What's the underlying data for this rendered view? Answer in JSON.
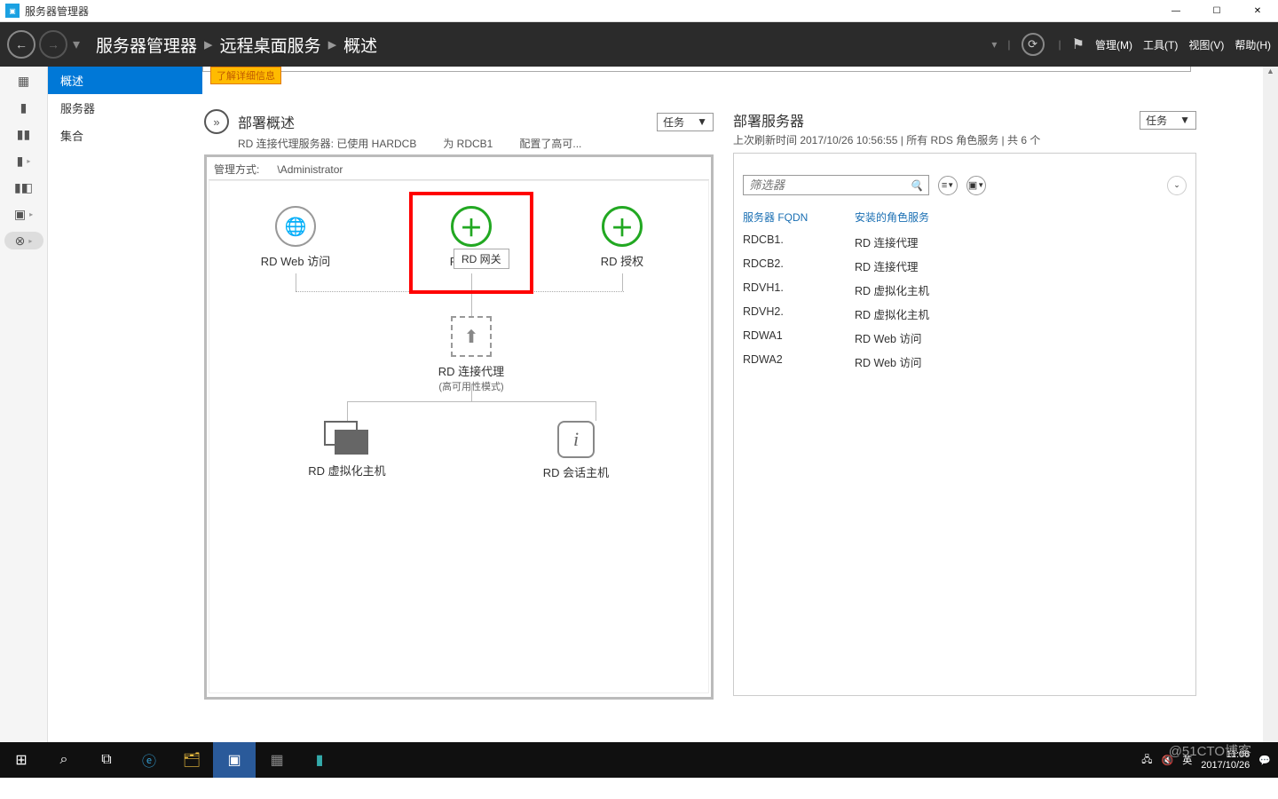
{
  "title": "服务器管理器",
  "winbtns": {
    "min": "—",
    "max": "☐",
    "close": "✕"
  },
  "breadcrumb": {
    "a": "服务器管理器",
    "b": "远程桌面服务",
    "c": "概述",
    "sep": "▸"
  },
  "menus": {
    "manage": "管理(M)",
    "tools": "工具(T)",
    "view": "视图(V)",
    "help": "帮助(H)"
  },
  "leftnav": {
    "overview": "概述",
    "servers": "服务器",
    "collections": "集合"
  },
  "notice": "了解详细信息",
  "deploy": {
    "title": "部署概述",
    "sub1": "RD 连接代理服务器: 已使用 HARDCB",
    "sub2": "为 RDCB1",
    "sub3": "配置了高可...",
    "tasks": "任务",
    "mgmt_label": "管理方式:",
    "mgmt_val": "\\Administrator",
    "nodes": {
      "web": "RD Web 访问",
      "gw": "RD 网关",
      "auth": "RD 授权",
      "broker": "RD 连接代理",
      "broker_sub": "(高可用性模式)",
      "vhost": "RD 虚拟化主机",
      "shost": "RD 会话主机"
    },
    "tooltip": "RD 网关"
  },
  "servers": {
    "title": "部署服务器",
    "sub": "上次刷新时间 2017/10/26 10:56:55 | 所有 RDS 角色服务  | 共 6 个",
    "tasks": "任务",
    "filter_ph": "筛选器",
    "headers": {
      "fqdn": "服务器 FQDN",
      "role": "安装的角色服务"
    },
    "rows": [
      {
        "fqdn": "RDCB1.",
        "role": "RD 连接代理"
      },
      {
        "fqdn": "RDCB2.",
        "role": "RD 连接代理"
      },
      {
        "fqdn": "RDVH1.",
        "role": "RD 虚拟化主机"
      },
      {
        "fqdn": "RDVH2.",
        "role": "RD 虚拟化主机"
      },
      {
        "fqdn": "RDWA1",
        "role": "RD Web 访问"
      },
      {
        "fqdn": "RDWA2",
        "role": "RD Web 访问"
      }
    ]
  },
  "tray": {
    "ime": "英",
    "time": "11:06",
    "date": "2017/10/26",
    "wm": "@51CTO博客"
  }
}
